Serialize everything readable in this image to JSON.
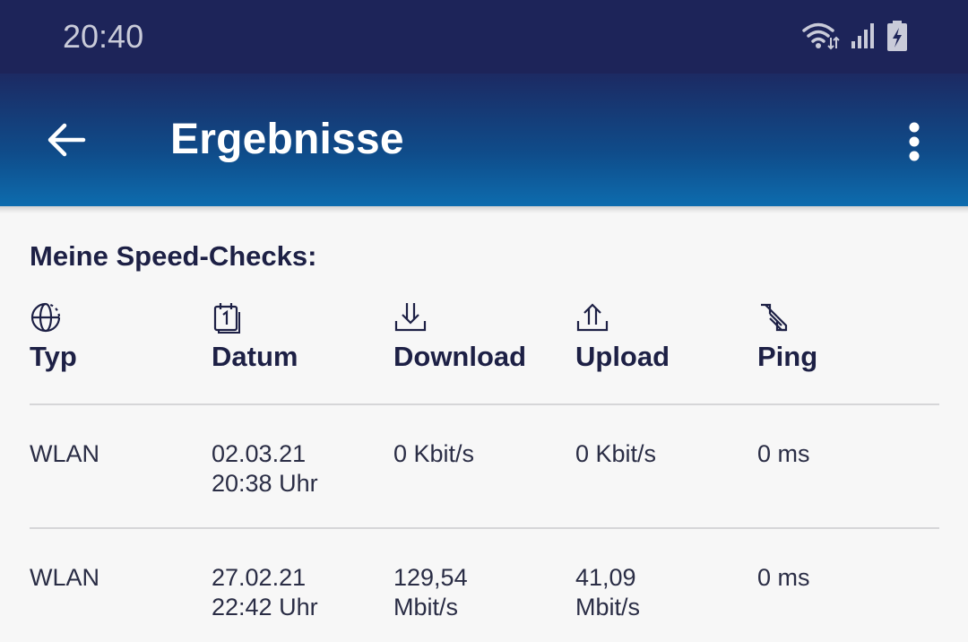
{
  "status_bar": {
    "time": "20:40",
    "icons": [
      "wifi-icon",
      "cellular-signal-icon",
      "battery-charging-icon"
    ]
  },
  "app_bar": {
    "title": "Ergebnisse",
    "back_icon": "arrow-left-icon",
    "menu_icon": "more-vertical-icon",
    "gradient_colors": [
      "#1c2a63",
      "#0d6cae"
    ]
  },
  "section_title": "Meine Speed-Checks:",
  "columns": [
    {
      "label": "Typ",
      "icon": "globe-icon"
    },
    {
      "label": "Datum",
      "icon": "calendar-icon"
    },
    {
      "label": "Download",
      "icon": "download-icon"
    },
    {
      "label": "Upload",
      "icon": "upload-icon"
    },
    {
      "label": "Ping",
      "icon": "ping-icon"
    }
  ],
  "rows": [
    {
      "typ": "WLAN",
      "datum": [
        "02.03.21",
        "20:38 Uhr"
      ],
      "download": [
        "0 Kbit/s"
      ],
      "upload": [
        "0 Kbit/s"
      ],
      "ping": "0 ms"
    },
    {
      "typ": "WLAN",
      "datum": [
        "27.02.21",
        "22:42 Uhr"
      ],
      "download": [
        "129,54",
        "Mbit/s"
      ],
      "upload": [
        "41,09",
        "Mbit/s"
      ],
      "ping": "0 ms"
    }
  ]
}
